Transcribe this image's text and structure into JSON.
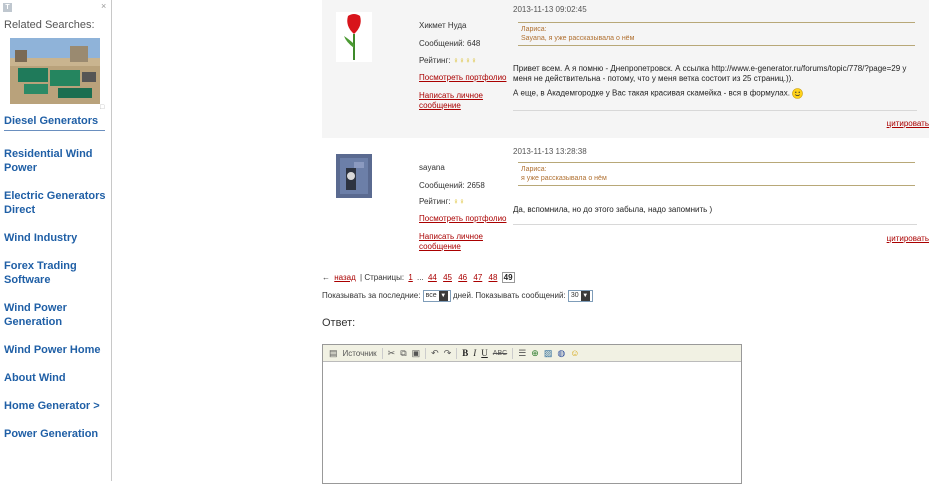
{
  "sidebar": {
    "related_title": "Related Searches:",
    "links": [
      "Diesel Generators",
      "Residential Wind Power",
      "Electric Generators Direct",
      "Wind Industry",
      "Forex Trading Software",
      "Wind Power Generation",
      "Wind Power Home",
      "About Wind",
      "Home Generator >",
      "Power Generation"
    ]
  },
  "posts": [
    {
      "author": "Хикмет Нуда",
      "messages": "Сообщений: 648",
      "rating_label": "Рейтинг:",
      "rating_stars": "♀♀♀♀",
      "portfolio_link": "Посмотреть портфолио",
      "pm_link": "Написать личное сообщение",
      "timestamp": "2013-11-13 09:02:45",
      "quote_author": "Лариса:",
      "quote_text": "Sayana, я уже рассказывала о нём",
      "body": "Привет всем. А я помню - Днепропетровск. А ссылка http://www.e-generator.ru/forums/topic/778/?page=29 у меня не действительна - потому, что у меня ветка состоит из 25 страниц.)).",
      "body2": "А еще, в Академгородке у Вас такая красивая скамейка - вся в формулах.",
      "quote_link": "цитировать"
    },
    {
      "author": "sayana",
      "messages": "Сообщений: 2658",
      "rating_label": "Рейтинг:",
      "rating_stars": "♀♀",
      "portfolio_link": "Посмотреть портфолио",
      "pm_link": "Написать личное сообщение",
      "timestamp": "2013-11-13 13:28:38",
      "quote_author": "Лариса:",
      "quote_text": "я уже рассказывала о нём",
      "body": "Да, вспомнила, но до этого забыла, надо запомнить )",
      "quote_link": "цитировать"
    }
  ],
  "pager": {
    "back": "назад",
    "pages_label": "| Страницы:",
    "first": "1",
    "ellipsis": "...",
    "pages": [
      "44",
      "45",
      "46",
      "47",
      "48"
    ],
    "current": "49"
  },
  "filters": {
    "show_last_label": "Показывать за последние:",
    "period_value": "все",
    "days_label": "дней. Показывать сообщений:",
    "count_value": "30"
  },
  "answer_label": "Ответ:",
  "editor": {
    "source_label": "Источник"
  }
}
